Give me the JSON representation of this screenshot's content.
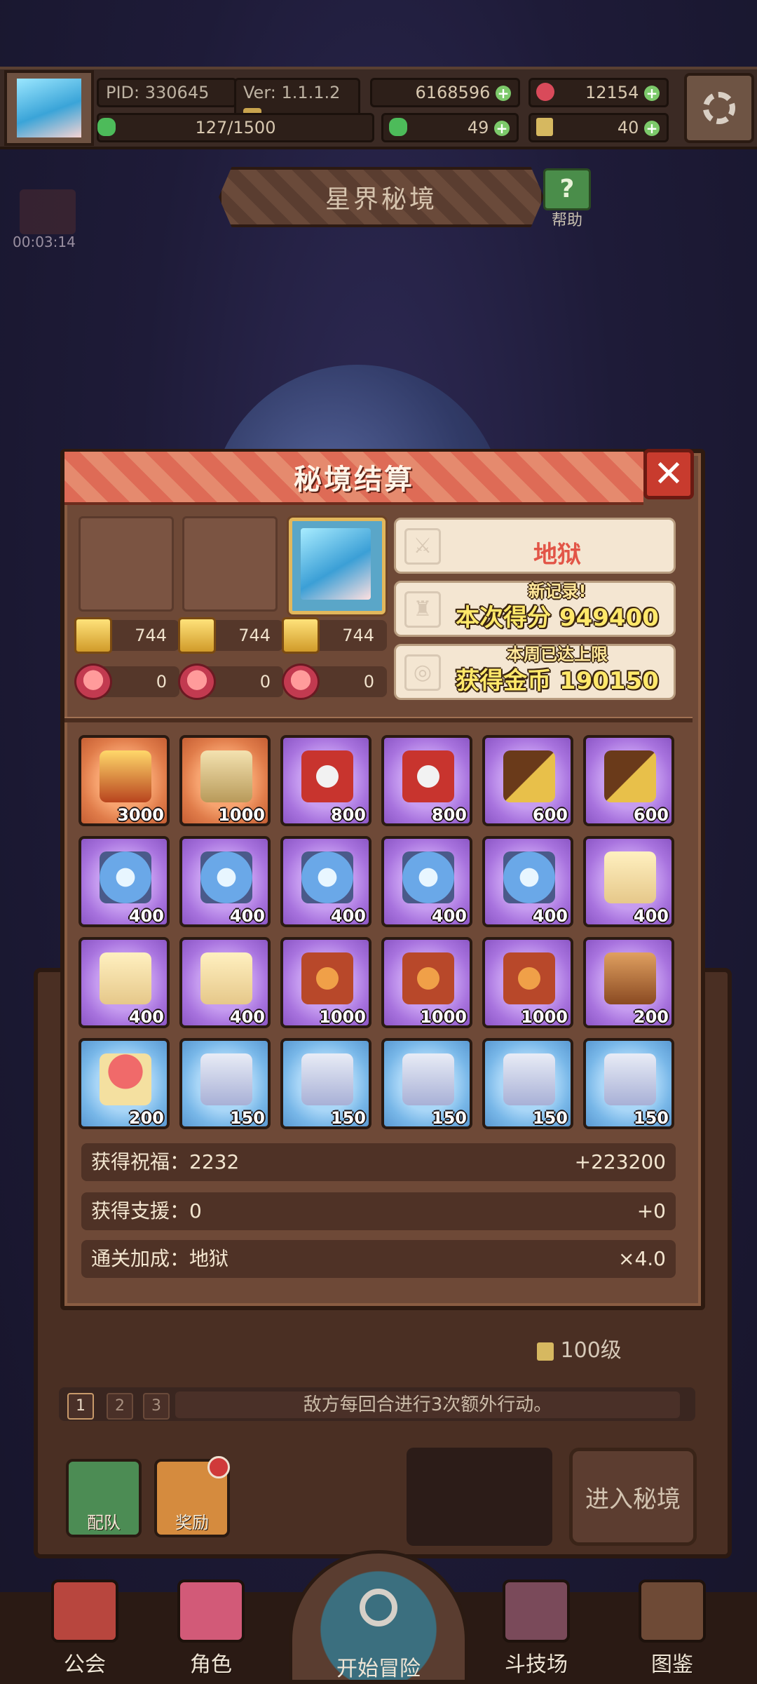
{
  "status": {
    "pid": "PID: 330645",
    "version": "Ver: 1.1.1.2",
    "gold": "6168596",
    "hearts": "12154",
    "exp": "127/1500",
    "clovers": "49",
    "keys": "40"
  },
  "timer": "00:03:14",
  "banner_title": "星界秘境",
  "help_label": "帮助",
  "modal": {
    "title": "秘境结算",
    "stats": [
      {
        "gold": "744",
        "pink": "0"
      },
      {
        "gold": "744",
        "pink": "0"
      },
      {
        "gold": "744",
        "pink": "0"
      }
    ],
    "difficulty": "地狱",
    "new_record_label": "新记录!",
    "score_text": "本次得分 949400",
    "weekly_limit_label": "本周已达上限",
    "coins_text": "获得金币 190150",
    "rewards": [
      {
        "icon": "golden-armor-icon",
        "rarity": "orange",
        "qty": "3000"
      },
      {
        "icon": "map-scroll-icon",
        "rarity": "orange",
        "qty": "1000"
      },
      {
        "icon": "red-helmet-icon",
        "rarity": "purple",
        "qty": "800"
      },
      {
        "icon": "red-helmet-icon",
        "rarity": "purple",
        "qty": "800"
      },
      {
        "icon": "spyglass-icon",
        "rarity": "purple",
        "qty": "600"
      },
      {
        "icon": "spyglass-icon",
        "rarity": "purple",
        "qty": "600"
      },
      {
        "icon": "crystal-orb-icon",
        "rarity": "purple",
        "qty": "400"
      },
      {
        "icon": "crystal-orb-icon",
        "rarity": "purple",
        "qty": "400"
      },
      {
        "icon": "crystal-orb-icon",
        "rarity": "purple",
        "qty": "400"
      },
      {
        "icon": "crystal-orb-icon",
        "rarity": "purple",
        "qty": "400"
      },
      {
        "icon": "crystal-orb-icon",
        "rarity": "purple",
        "qty": "400"
      },
      {
        "icon": "scroll-icon",
        "rarity": "purple",
        "qty": "400"
      },
      {
        "icon": "scroll-icon",
        "rarity": "purple",
        "qty": "400"
      },
      {
        "icon": "scroll-icon",
        "rarity": "purple",
        "qty": "400"
      },
      {
        "icon": "treasure-pouch-icon",
        "rarity": "purple",
        "qty": "1000"
      },
      {
        "icon": "treasure-pouch-icon",
        "rarity": "purple",
        "qty": "1000"
      },
      {
        "icon": "treasure-pouch-icon",
        "rarity": "purple",
        "qty": "1000"
      },
      {
        "icon": "shield-badge-icon",
        "rarity": "purple",
        "qty": "200"
      },
      {
        "icon": "mushroom-icon",
        "rarity": "blue",
        "qty": "200"
      },
      {
        "icon": "potion-jar-icon",
        "rarity": "blue",
        "qty": "150"
      },
      {
        "icon": "potion-jar-icon",
        "rarity": "blue",
        "qty": "150"
      },
      {
        "icon": "potion-jar-icon",
        "rarity": "blue",
        "qty": "150"
      },
      {
        "icon": "potion-jar-icon",
        "rarity": "blue",
        "qty": "150"
      },
      {
        "icon": "potion-jar-icon",
        "rarity": "blue",
        "qty": "150"
      }
    ],
    "summary": [
      {
        "label": "获得祝福：2232",
        "value": "+223200"
      },
      {
        "label": "获得支援：0",
        "value": "+0"
      },
      {
        "label": "通关加成：地狱",
        "value": "×4.0"
      }
    ]
  },
  "level_text": "100级",
  "stage_numbers": [
    "1",
    "2",
    "3"
  ],
  "stage_desc": "敌方每回合进行3次额外行动。",
  "team_label": "配队",
  "reward_label": "奖励",
  "enter_label": "进入秘境",
  "nav": [
    "公会",
    "角色",
    "开始冒险",
    "斗技场",
    "图鉴"
  ],
  "colors": {
    "orange": "#e07c4a",
    "purple": "#a873de",
    "blue": "#78b7e8",
    "hell_red": "#e25547"
  }
}
